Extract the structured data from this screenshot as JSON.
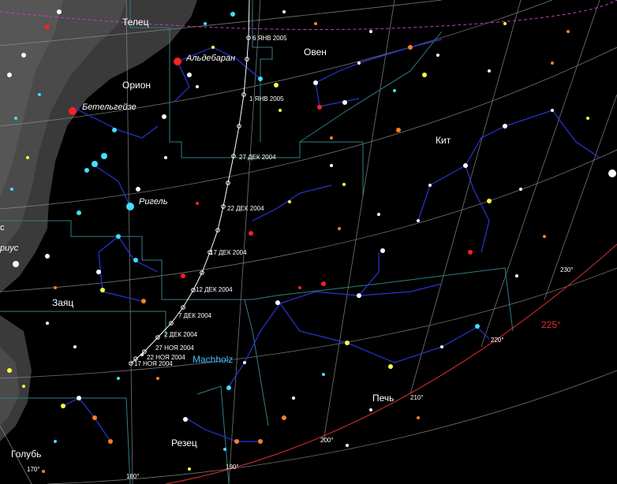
{
  "constellations": [
    "Телец",
    "Овен",
    "Орион",
    "Кит",
    "Заяц",
    "Печь",
    "Резец",
    "Голубь"
  ],
  "star_names": [
    "Альдебаран",
    "Бетельгейзе",
    "Ригель"
  ],
  "partial_labels": [
    "с",
    "риус"
  ],
  "comet": {
    "name": "Machholz",
    "dates": [
      "6 ЯНВ 2005",
      "1 ЯНВ 2005",
      "27 ДЕК 2004",
      "22 ДЕК 2004",
      "17 ДЕК 2004",
      "12 ДЕК 2004",
      "7 ДЕК 2004",
      "2 ДЕК 2004",
      "27 НОЯ 2004",
      "22 НОЯ 2004",
      "17 НОЯ 2004"
    ]
  },
  "horizon_azimuth": "225°",
  "azimuth_ticks": [
    "230°",
    "220°",
    "210°",
    "200°",
    "190°",
    "180°",
    "170°"
  ],
  "colors": {
    "background": "#000000",
    "grid": "#bdbdbd",
    "constellation_lines": "#2a34d8",
    "boundaries": "#2f7f87",
    "ecliptic": "#c040c0",
    "horizon": "#e03030",
    "comet_path": "#ffffff",
    "comet_label": "#40c0ff",
    "milky_way": "#4a4a4a"
  }
}
